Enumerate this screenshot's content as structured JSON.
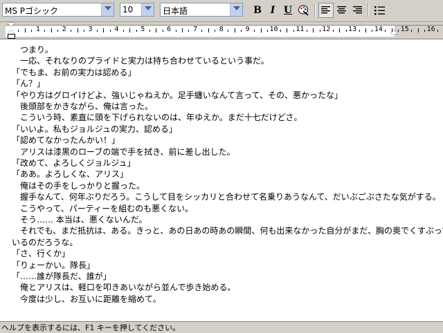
{
  "toolbar": {
    "font_name": "MS Pゴシック",
    "font_size": "10",
    "script": "日本語",
    "bold": "B",
    "italic": "I",
    "underline": "U",
    "icons": [
      "chevron-down-icon",
      "bold-icon",
      "italic-icon",
      "underline-icon",
      "color-palette-icon",
      "align-left-icon",
      "align-center-icon",
      "align-right-icon",
      "bullet-list-icon"
    ]
  },
  "ruler": {
    "numbers": [
      "1",
      "2",
      "3",
      "4",
      "5",
      "6",
      "7",
      "8",
      "9",
      "10",
      "11",
      "12",
      "13",
      "14",
      "15",
      "16"
    ]
  },
  "document": {
    "paragraphs": [
      "　つまり。",
      "　一応、それなりのプライドと実力は持ち合わせているという事だ。",
      "「でもま、お前の実力は認める」",
      "「ん？」",
      "「やり方はグロイけどよ、強いじゃねえか。足手纏いなんて言って、その、悪かったな」",
      "　後頭部をかきながら、俺は言った。",
      "　こういう時、素直に頭を下げられないのは、年ゆえか。まだ十七だけどさ。",
      "「いいよ。私もジョルジュの実力、認める」",
      "「認めてなかったんかい！」",
      "　アリスは漆黒のローブの端で手を拭き、前に差し出した。",
      "「改めて、よろしくジョルジュ」",
      "「ああ。よろしくな、アリス」",
      "　俺はその手をしっかりと握った。",
      "　握手なんて、何年ぶりだろう。こうして目をシッカリと合わせて名乗りあうなんて、だいぶごぶさたな気がする。",
      "　こうやって、パーティーを組むのも悪くない。",
      "　そう…… 本当は、悪くないんだ。",
      "　それでも、まだ抵抗は、ある。きっと、あの日あの時あの瞬間、何も出来なかった自分がまだ、胸の奥でくすぶって",
      "いるのだろうな。",
      "「さ、行くか」",
      "「りょーかい。隊長」",
      "「……誰が隊長だ、誰が」",
      "　俺とアリスは、軽口を叩きあいながら並んで歩き始める。",
      "　今度は少し、お互いに距離を縮めて。"
    ]
  },
  "statusbar": {
    "text": "ヘルプを表示するには、F1 キーを押してください。"
  }
}
